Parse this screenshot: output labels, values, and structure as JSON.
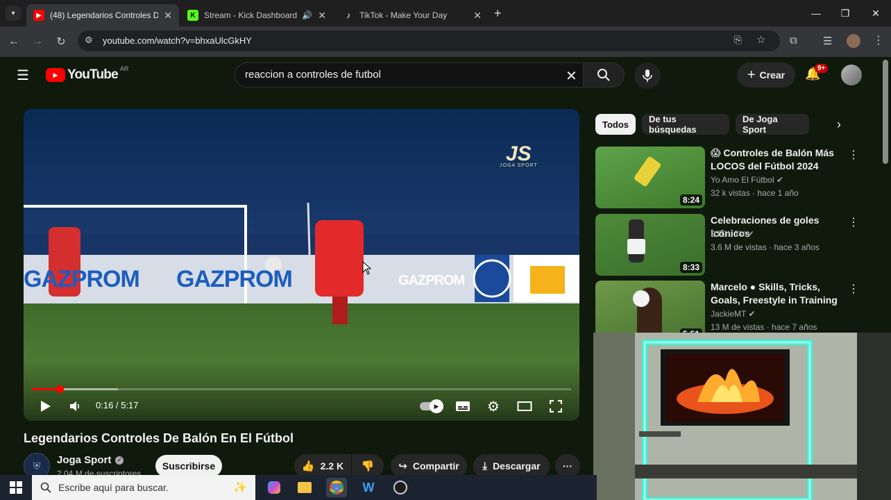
{
  "browser": {
    "tabs": [
      {
        "title": "(48) Legendarios Controles De B",
        "icon": "youtube-icon",
        "active": true
      },
      {
        "title": "Stream - Kick Dashboard",
        "icon": "kick-icon",
        "active": false,
        "audio": true
      },
      {
        "title": "TikTok - Make Your Day",
        "icon": "tiktok-icon",
        "active": false
      }
    ],
    "url": "youtube.com/watch?v=bhxaUlcGkHY"
  },
  "youtube": {
    "logo_text": "YouTube",
    "region": "AR",
    "search_query": "reaccion a controles de futbol",
    "create_label": "Crear",
    "notif_badge": "9+"
  },
  "player": {
    "watermark": "JS",
    "watermark_sub": "JOGA SPORT",
    "time": "0:16 / 5:17",
    "progress_played": 0.052,
    "progress_buffered": 0.16,
    "board_words": [
      "GAZPROM",
      "GAZPROM",
      "GAZPROM"
    ]
  },
  "video": {
    "title": "Legendarios Controles De Balón En El Fútbol",
    "channel": "Joga Sport",
    "subscribers": "2,04 M de suscriptores",
    "subscribe_label": "Suscribirse",
    "likes": "2.2 K",
    "share_label": "Compartir",
    "download_label": "Descargar"
  },
  "chips": [
    "Todos",
    "De tus búsquedas",
    "De Joga Sport"
  ],
  "recommendations": [
    {
      "title": "😱 Controles de Balón Más LOCOS del Fútbol 2024",
      "channel": "Yo Amo El Fútbol",
      "meta": "32 k vistas · hace 1 año",
      "duration": "8:24"
    },
    {
      "title": "Celebraciones de goles icónicos",
      "channel": "BTGL TV",
      "meta": "3.6 M de vistas · hace 3 años",
      "duration": "8:33"
    },
    {
      "title": "Marcelo ● Skills, Tricks, Goals, Freestyle in Training",
      "channel": "JackieMT",
      "meta": "13 M de vistas · hace 7 años",
      "duration": "5:51"
    }
  ],
  "taskbar": {
    "search_placeholder": "Escribe aquí para buscar."
  },
  "colors": {
    "yt_red": "#ff0000",
    "kick_green": "#53fc18",
    "chrome_dark": "#35363a"
  }
}
